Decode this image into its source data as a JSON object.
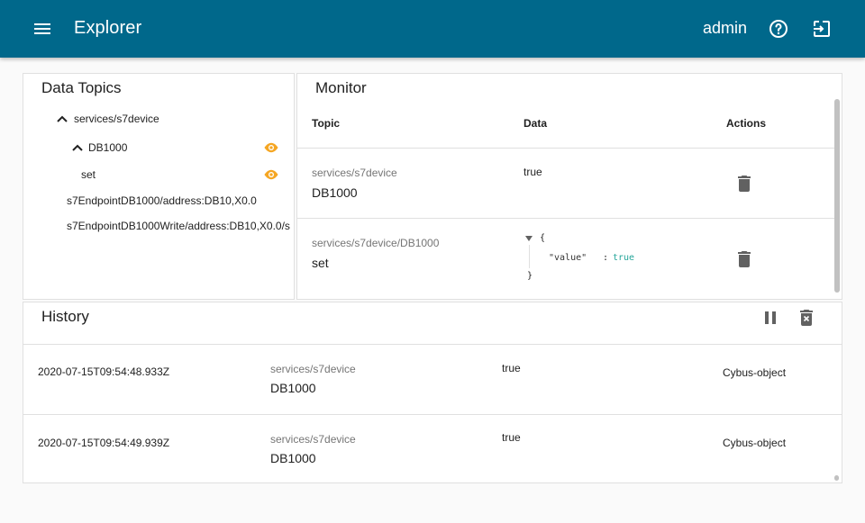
{
  "app": {
    "title": "Explorer",
    "user": "admin"
  },
  "icons": {
    "menu": "menu-icon",
    "help": "help-circle-icon",
    "logout": "exit-to-app-icon",
    "eye": "eye-icon",
    "trash": "delete-icon",
    "pause": "pause-icon",
    "clear": "delete-sweep-icon"
  },
  "colors": {
    "appbar": "#00688b",
    "eye": "#f5a623",
    "json_bool": "#26a69a"
  },
  "topics": {
    "title": "Data Topics",
    "items": [
      {
        "label": "services/s7device",
        "expanded": true
      },
      {
        "label": "DB1000",
        "expanded": true
      },
      {
        "label": "set"
      },
      {
        "label": "s7EndpointDB1000/address:DB10,X0.0"
      },
      {
        "label": "s7EndpointDB1000Write/address:DB10,X0.0/s"
      }
    ]
  },
  "monitor": {
    "title": "Monitor",
    "headers": {
      "topic": "Topic",
      "data": "Data",
      "actions": "Actions"
    },
    "rows": [
      {
        "path": "services/s7device",
        "name": "DB1000",
        "data": "true"
      },
      {
        "path": "services/s7device/DB1000",
        "name": "set",
        "json": {
          "open": "{",
          "key": "\"value\"",
          "colon": ":",
          "value": "true",
          "close": "}"
        }
      }
    ]
  },
  "history": {
    "title": "History",
    "rows": [
      {
        "timestamp": "2020-07-15T09:54:48.933Z",
        "path": "services/s7device",
        "name": "DB1000",
        "data": "true",
        "source": "Cybus-object"
      },
      {
        "timestamp": "2020-07-15T09:54:49.939Z",
        "path": "services/s7device",
        "name": "DB1000",
        "data": "true",
        "source": "Cybus-object"
      }
    ]
  }
}
